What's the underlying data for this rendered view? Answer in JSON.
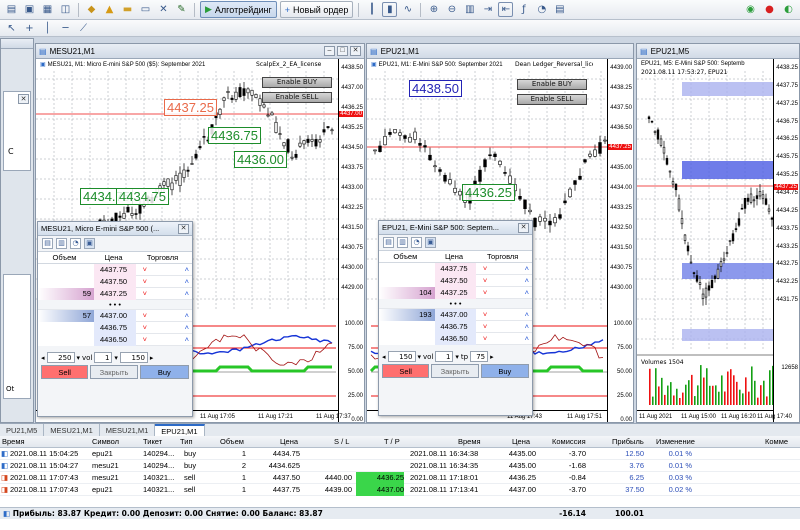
{
  "toolbar": {
    "algo_label": "Алготрейдинг",
    "neworder_label": "Новый ордер",
    "colors": {
      "accent": "#2d6bc7",
      "buy": "#2355d6",
      "sell": "#e11717"
    }
  },
  "left_panel": {
    "fragment_label": "С"
  },
  "charts": {
    "mesu": {
      "title": "MESU21,M1",
      "info": "MESU21, M1: Micro E-mini S&P 500 ($5): September 2021",
      "ea": "ScalpEx_2_EA_license",
      "enable_buy": "Enable BUY",
      "enable_sell": "Enable SELL",
      "labels": [
        "4437.25",
        "4436.75",
        "4436.00",
        "4434.75",
        "4434.75"
      ],
      "prices": [
        "4438.50",
        "4437.00",
        "4436.25",
        "4435.25",
        "4434.50",
        "4433.75",
        "4433.00",
        "4432.25",
        "4431.50",
        "4430.75",
        "4430.00",
        "4429.00"
      ],
      "current": "4437.00",
      "osc": [
        "100.00",
        "75.00",
        "50.00",
        "25.00",
        "0.00"
      ],
      "times": [
        "11 Aug 17:05",
        "11 Aug 17:21",
        "11 Aug 17:37"
      ]
    },
    "epu": {
      "title": "EPU21,M1",
      "info": "EPU21, M1: E-Mini S&P 500: September 2021",
      "ea": "Dean Ledger_Reversal_license",
      "enable_buy": "Enable BUY",
      "enable_sell": "Enable SELL",
      "labels": [
        "4438.50",
        "4436.25"
      ],
      "prices": [
        "4439.00",
        "4438.25",
        "4437.50",
        "4436.50",
        "4435.75",
        "4435.00",
        "4434.00",
        "4433.25",
        "4432.50",
        "4431.50",
        "4430.75",
        "4430.00"
      ],
      "current": "4437.25",
      "osc": [
        "100.00",
        "75.00",
        "50.00",
        "25.00",
        "0.00"
      ],
      "times": [
        "11 Aug 17:43",
        "11 Aug 17:51"
      ]
    },
    "epu5": {
      "title": "EPU21,M5",
      "info": "EPU21, M5: E-Mini S&P 500: Septemb",
      "sub": "2021.08.11 17:53:27, EPU21",
      "prices": [
        "4438.25",
        "4437.75",
        "4437.25",
        "4436.75",
        "4436.25",
        "4435.75",
        "4435.25",
        "4434.75",
        "4434.25",
        "4433.75",
        "4433.25",
        "4432.75",
        "4432.25",
        "4431.75"
      ],
      "current": "4437.25",
      "volume_label": "Volumes 1504",
      "vol_max": "12658",
      "times": [
        "11 Aug 2021",
        "11 Aug 15:00",
        "11 Aug 16:20",
        "11 Aug 17:40"
      ]
    }
  },
  "dom_mesu": {
    "title": "MESU21, Micro E-mini S&P 500 (...",
    "hdr": {
      "vol": "Объем",
      "price": "Цена",
      "trade": "Торговля"
    },
    "asks": [
      {
        "vol": "",
        "price": "4437.75"
      },
      {
        "vol": "",
        "price": "4437.50"
      },
      {
        "vol": "59",
        "price": "4437.25"
      }
    ],
    "dots": "• • •",
    "bids": [
      {
        "vol": "57",
        "price": "4437.00"
      },
      {
        "vol": "",
        "price": "4436.75"
      },
      {
        "vol": "",
        "price": "4436.50"
      }
    ],
    "qty_left": "250",
    "vol_label": "vol",
    "vol_value": "1",
    "qty_right": "150",
    "sell": "Sell",
    "close": "Закрыть",
    "buy": "Buy"
  },
  "dom_epu": {
    "title": "EPU21, E-Mini S&P 500: Septem...",
    "hdr": {
      "vol": "Объем",
      "price": "Цена",
      "trade": "Торговля"
    },
    "asks": [
      {
        "vol": "",
        "price": "4437.75"
      },
      {
        "vol": "",
        "price": "4437.50"
      },
      {
        "vol": "104",
        "price": "4437.25"
      }
    ],
    "dots": "• • •",
    "bids": [
      {
        "vol": "193",
        "price": "4437.00"
      },
      {
        "vol": "",
        "price": "4436.75"
      },
      {
        "vol": "",
        "price": "4436.50"
      }
    ],
    "qty_left": "150",
    "vol_label": "vol",
    "vol_value": "1",
    "tp_label": "tp",
    "tp_value": "75",
    "sell": "Sell",
    "close": "Закрыть",
    "buy": "Buy"
  },
  "tabs": [
    "PU21,M5",
    "MESU21,M1",
    "MESU21,M1",
    "EPU21,M1"
  ],
  "trades": {
    "headers": {
      "time": "Время",
      "symbol": "Символ",
      "ticket": "Тикет",
      "type": "Тип",
      "volume": "Объем",
      "price": "Цена",
      "sl": "S / L",
      "tp": "T / P",
      "time2": "Время",
      "price2": "Цена",
      "commission": "Комиссия",
      "profit": "Прибыль",
      "change": "Изменение",
      "comment": "Комме"
    },
    "rows": [
      {
        "time": "2021.08.11 15:04:25",
        "symbol": "epu21",
        "ticket": "140294...",
        "type": "buy",
        "volume": "1",
        "price": "4434.75",
        "sl": "",
        "tp": "",
        "time2": "2021.08.11 16:34:38",
        "price2": "4435.00",
        "commission": "-3.70",
        "profit": "12.50",
        "change": "0.01 %"
      },
      {
        "time": "2021.08.11 15:04:27",
        "symbol": "mesu21",
        "ticket": "140294...",
        "type": "buy",
        "volume": "2",
        "price": "4434.625",
        "sl": "",
        "tp": "",
        "time2": "2021.08.11 16:34:35",
        "price2": "4435.00",
        "commission": "-1.68",
        "profit": "3.76",
        "change": "0.01 %"
      },
      {
        "time": "2021.08.11 17:07:43",
        "symbol": "mesu21",
        "ticket": "140321...",
        "type": "sell",
        "volume": "1",
        "price": "4437.50",
        "sl": "4440.00",
        "tp": "4436.25",
        "time2": "2021.08.11 17:18:01",
        "price2": "4436.25",
        "commission": "-0.84",
        "profit": "6.25",
        "change": "0.03 %"
      },
      {
        "time": "2021.08.11 17:07:43",
        "symbol": "epu21",
        "ticket": "140321...",
        "type": "sell",
        "volume": "1",
        "price": "4437.75",
        "sl": "4439.00",
        "tp": "4437.00",
        "time2": "2021.08.11 17:13:41",
        "price2": "4437.00",
        "commission": "-3.70",
        "profit": "37.50",
        "change": "0.02 %"
      }
    ],
    "footer": {
      "summary": "Прибыль: 83.87  Кредит: 0.00  Депозит: 0.00  Снятие: 0.00  Баланс: 83.87",
      "commission_total": "-16.14",
      "profit_total": "100.01"
    }
  }
}
